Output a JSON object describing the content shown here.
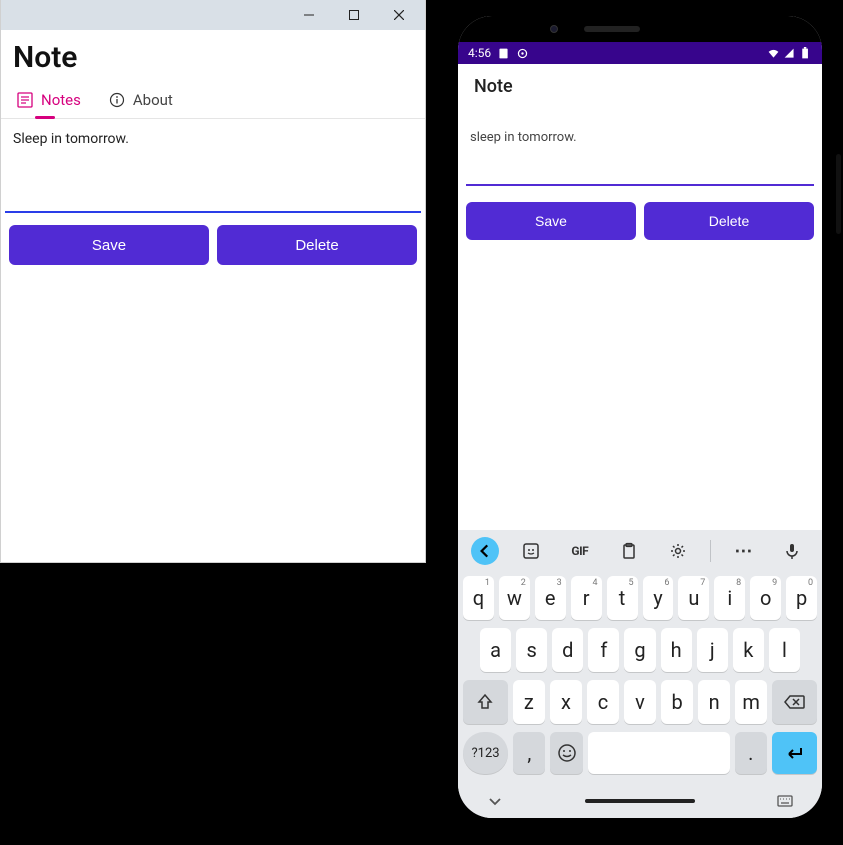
{
  "desktop": {
    "title": "Note",
    "tabs": {
      "notes": "Notes",
      "about": "About"
    },
    "note_value": "Sleep in tomorrow.",
    "buttons": {
      "save": "Save",
      "delete": "Delete"
    }
  },
  "phone": {
    "status_time": "4:56",
    "header_title": "Note",
    "note_value": "sleep in tomorrow.",
    "buttons": {
      "save": "Save",
      "delete": "Delete"
    }
  },
  "keyboard": {
    "toolbar": {
      "gif": "GIF",
      "more": "⋯"
    },
    "row1": [
      {
        "k": "q",
        "s": "1"
      },
      {
        "k": "w",
        "s": "2"
      },
      {
        "k": "e",
        "s": "3"
      },
      {
        "k": "r",
        "s": "4"
      },
      {
        "k": "t",
        "s": "5"
      },
      {
        "k": "y",
        "s": "6"
      },
      {
        "k": "u",
        "s": "7"
      },
      {
        "k": "i",
        "s": "8"
      },
      {
        "k": "o",
        "s": "9"
      },
      {
        "k": "p",
        "s": "0"
      }
    ],
    "row2": [
      "a",
      "s",
      "d",
      "f",
      "g",
      "h",
      "j",
      "k",
      "l"
    ],
    "row3": [
      "z",
      "x",
      "c",
      "v",
      "b",
      "n",
      "m"
    ],
    "sym": "?123",
    "comma": ",",
    "period": "."
  }
}
